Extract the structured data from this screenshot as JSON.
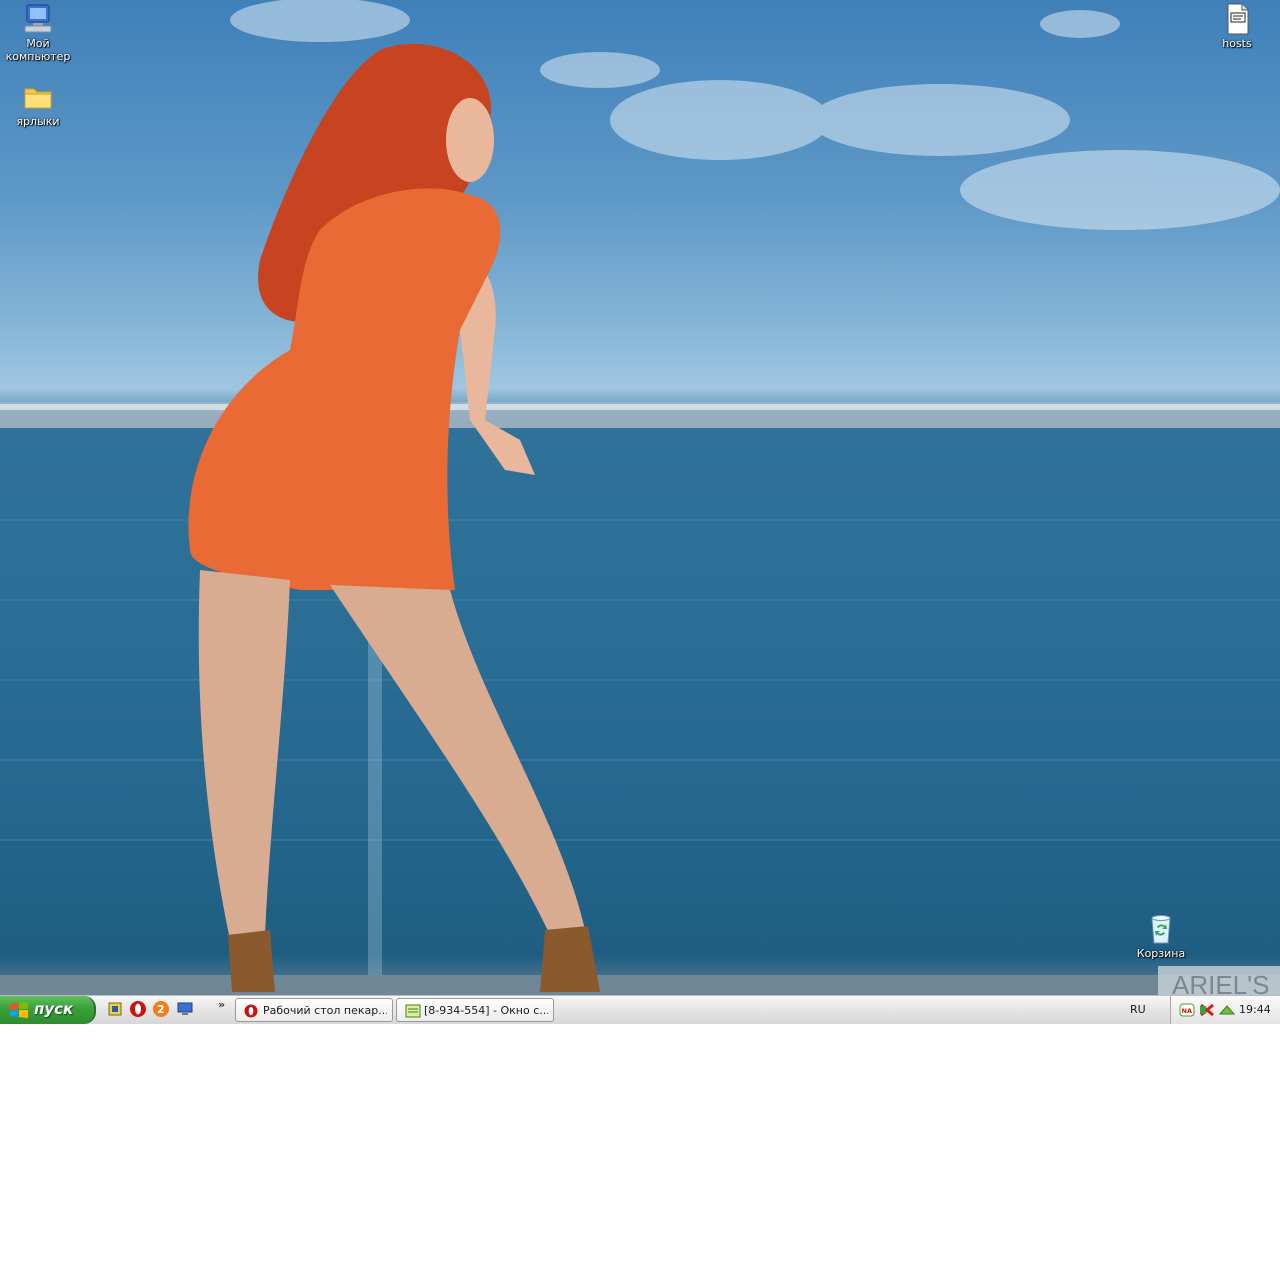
{
  "desktop": {
    "icons": [
      {
        "name": "my-computer",
        "label": "Мой компьютер"
      },
      {
        "name": "shortcuts-folder",
        "label": "ярлыки"
      },
      {
        "name": "hosts-file",
        "label": "hosts"
      },
      {
        "name": "recycle-bin",
        "label": "Корзина"
      }
    ],
    "wallpaper_watermark": "ARIEL'S"
  },
  "taskbar": {
    "start_label": "пуск",
    "quick_launch": [
      "file-manager-icon",
      "opera-icon",
      "browser-icon",
      "show-desktop-icon"
    ],
    "quick_launch_overflow": "»",
    "tasks": [
      {
        "icon": "opera-icon",
        "label": "Рабочий стол пекар..."
      },
      {
        "icon": "chat-window-icon",
        "label": "[8-934-554] - Окно с..."
      }
    ],
    "language": "RU",
    "tray": {
      "icons": [
        "nvidia-icon",
        "antivirus-icon",
        "network-icon"
      ],
      "clock": "19:44"
    }
  },
  "colors": {
    "start_green": "#3aa13a",
    "taskbar_bg": "#e6e6e6",
    "opera_red": "#cc1111"
  }
}
